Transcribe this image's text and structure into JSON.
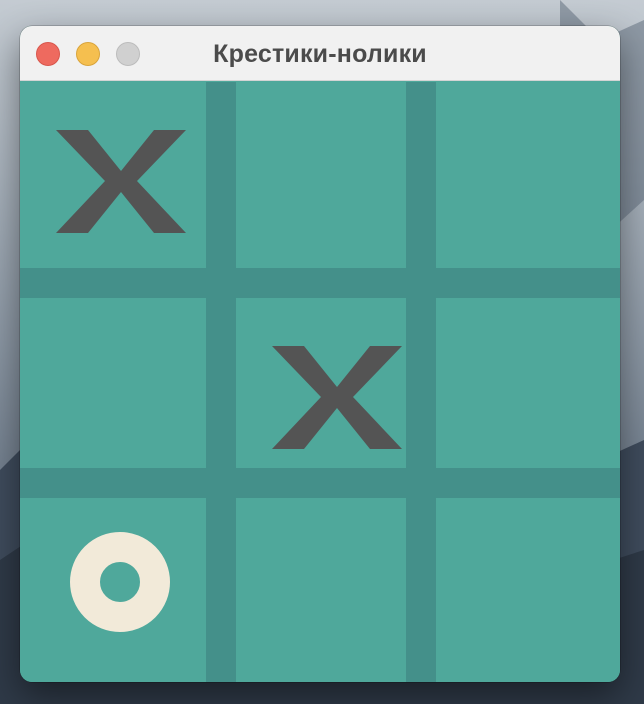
{
  "window": {
    "title": "Крестики-нолики"
  },
  "board": {
    "cells": [
      "X",
      "",
      "",
      "",
      "X",
      "",
      "O",
      "",
      ""
    ]
  },
  "colors": {
    "board": "#4fa89b",
    "grid": "#44908a",
    "x_mark": "#545454",
    "o_mark": "#f2ead9"
  }
}
